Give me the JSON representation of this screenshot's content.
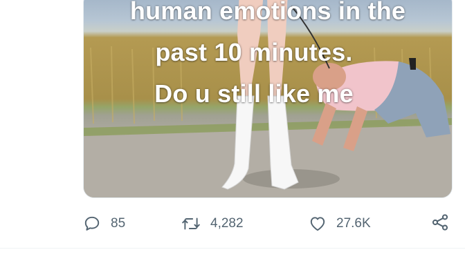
{
  "tweet": {
    "media": {
      "caption_lines": [
        "human emotions in the",
        "past 10 minutes.",
        "Do u still like me"
      ]
    },
    "actions": {
      "reply": {
        "icon": "speech-bubble-icon",
        "count": "85"
      },
      "retweet": {
        "icon": "retweet-arrows-icon",
        "count": "4,282"
      },
      "like": {
        "icon": "heart-icon",
        "count": "27.6K"
      },
      "share": {
        "icon": "share-icon"
      }
    }
  }
}
